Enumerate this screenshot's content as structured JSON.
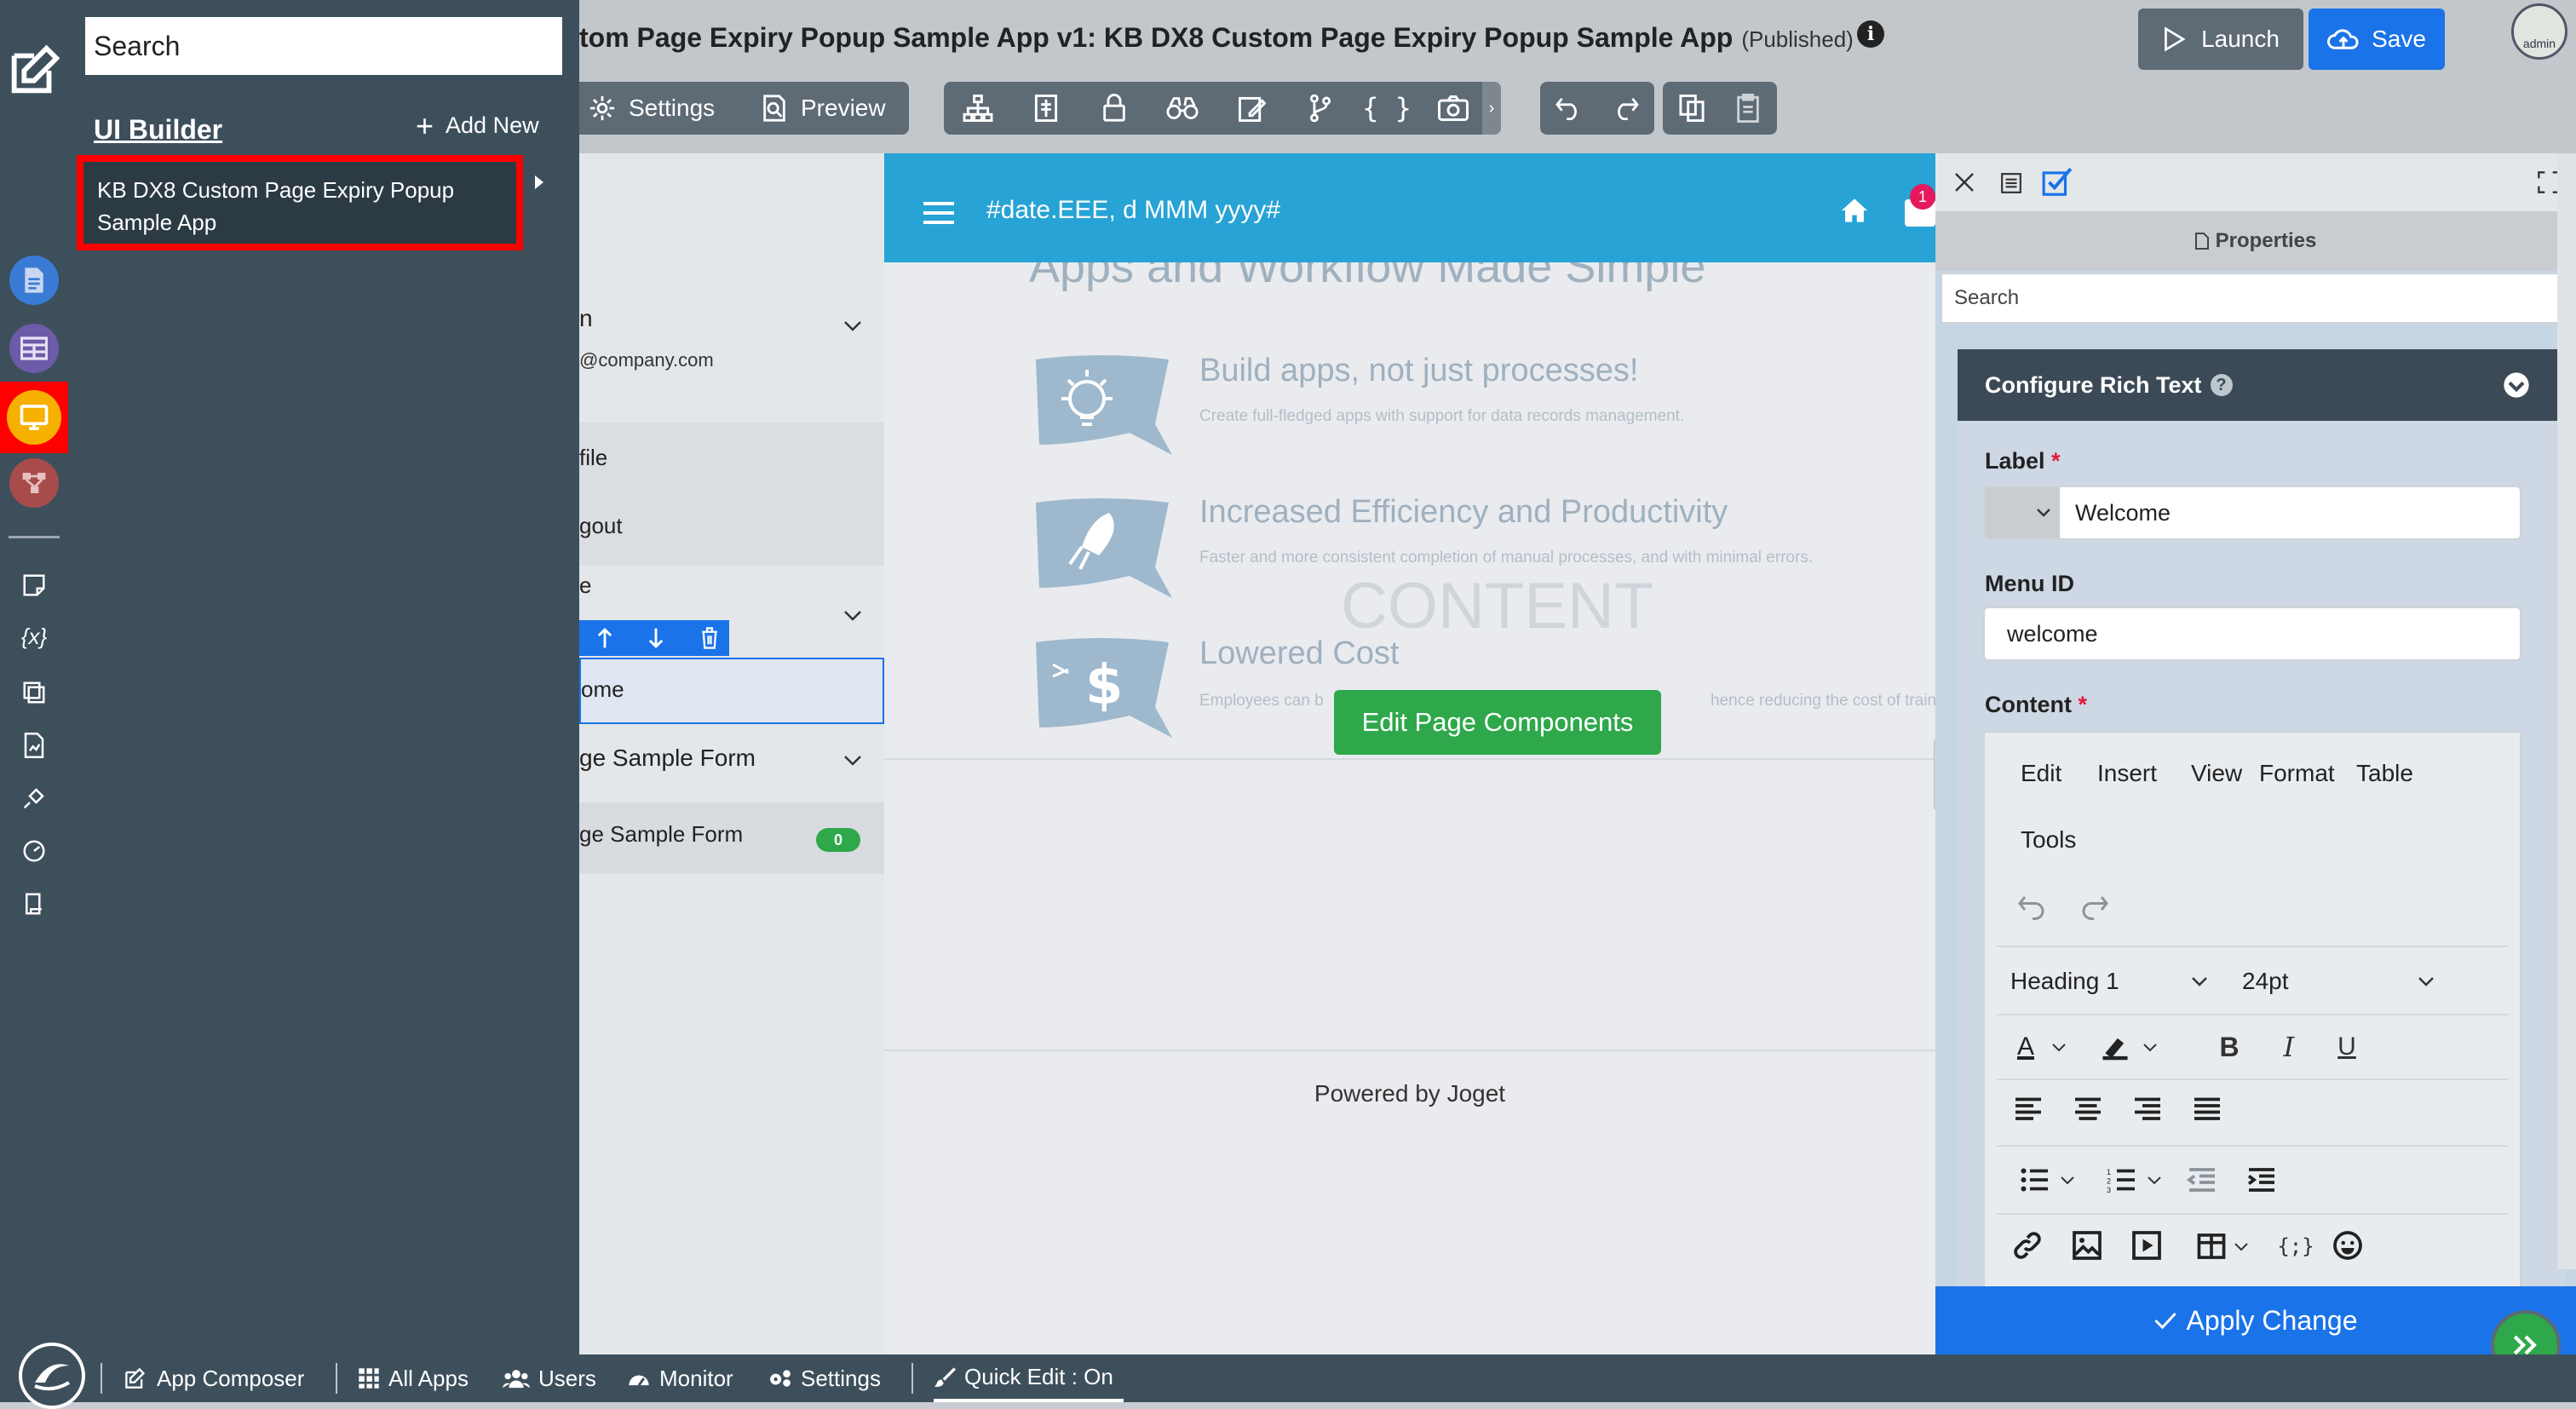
{
  "sidebar_search": {
    "placeholder": "Search"
  },
  "panel": {
    "title": "UI Builder",
    "add_new_label": "Add New",
    "selected_app": "KB DX8 Custom Page Expiry Popup Sample App"
  },
  "header": {
    "title": "tom Page Expiry Popup Sample App v1: KB DX8 Custom Page Expiry Popup Sample App",
    "status": "(Published)",
    "launch_label": "Launch",
    "save_label": "Save",
    "avatar_label": "admin"
  },
  "toolbar": {
    "settings_label": "Settings",
    "preview_label": "Preview"
  },
  "app_header": {
    "date_text": "#date.EEE, d MMM yyyy#",
    "notification_count": "1"
  },
  "nav": {
    "user_name": "n",
    "user_email": "@company.com",
    "profile": "file",
    "logout": "gout",
    "category": "e",
    "welcome": "ome",
    "form_category": "ge Sample Form",
    "form_item": "ge Sample Form",
    "form_count": "0"
  },
  "content": {
    "hero": "Apps and Workflow Made Simple",
    "features": [
      {
        "title": "Build apps, not just processes!",
        "desc": "Create full-fledged apps with support for data records management."
      },
      {
        "title": "Increased Efficiency and Productivity",
        "desc": "Faster and more consistent completion of manual processes, and with minimal errors."
      },
      {
        "title": "Lowered Cost",
        "desc": "Employees can b",
        "desc_tail": "hence reducing the cost of trainin"
      }
    ],
    "overlay_label": "CONTENT",
    "edit_button": "Edit Page Components",
    "footer": "Powered by Joget"
  },
  "properties": {
    "tab_label": "Properties",
    "search_placeholder": "Search",
    "section_title": "Configure Rich Text",
    "label_field": "Label",
    "label_value": "Welcome",
    "menu_id_field": "Menu ID",
    "menu_id_value": "welcome",
    "content_field": "Content",
    "editor_menu": [
      "Edit",
      "Insert",
      "View",
      "Format",
      "Table",
      "Tools"
    ],
    "block_format": "Heading 1",
    "font_size": "24pt",
    "apply_label": "Apply Change"
  },
  "bottom": {
    "app_composer": "App Composer",
    "all_apps": "All Apps",
    "users": "Users",
    "monitor": "Monitor",
    "settings": "Settings",
    "quick_edit": "Quick Edit : On"
  },
  "colors": {
    "primary_blue": "#1a73e8",
    "header_cyan": "#27a3d5",
    "dark_slate": "#3e4f5c",
    "highlight_red": "#ff0000",
    "success_green": "#2ea84a"
  }
}
